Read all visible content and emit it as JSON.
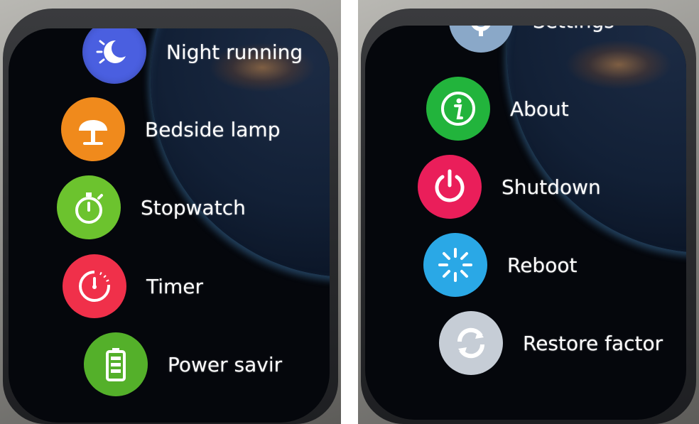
{
  "left_screen": {
    "items": [
      {
        "label": "Night running",
        "icon": "night-mode-icon",
        "color": "#4a5fe0"
      },
      {
        "label": "Bedside lamp",
        "icon": "lamp-icon",
        "color": "#f08a1c"
      },
      {
        "label": "Stopwatch",
        "icon": "stopwatch-icon",
        "color": "#6cc32e"
      },
      {
        "label": "Timer",
        "icon": "timer-icon",
        "color": "#f0304a"
      },
      {
        "label": "Power savir",
        "icon": "battery-icon",
        "color": "#54b02a"
      }
    ]
  },
  "right_screen": {
    "items": [
      {
        "label": "Settings",
        "icon": "gear-icon",
        "color": "#8aa8c8"
      },
      {
        "label": "About",
        "icon": "info-icon",
        "color": "#22b43c"
      },
      {
        "label": "Shutdown",
        "icon": "power-icon",
        "color": "#ea1e5a"
      },
      {
        "label": "Reboot",
        "icon": "reboot-icon",
        "color": "#2aa8e6"
      },
      {
        "label": "Restore factor",
        "icon": "restore-icon",
        "color": "#c6cdd6"
      }
    ]
  }
}
